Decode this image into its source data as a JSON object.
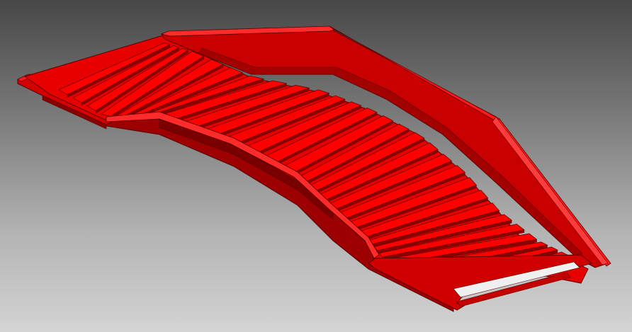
{
  "viewport": {
    "background_top": "#474747",
    "background_bottom": "#d4d4d4"
  },
  "model": {
    "kind": "curved-stair-stringer-3d-model",
    "tread_count": 28,
    "colors": {
      "face_light": "#ff0000",
      "face_mid": "#e00000",
      "face_dark": "#b80000",
      "face_shadow": "#8a0000",
      "edge": "#5a0000"
    }
  }
}
